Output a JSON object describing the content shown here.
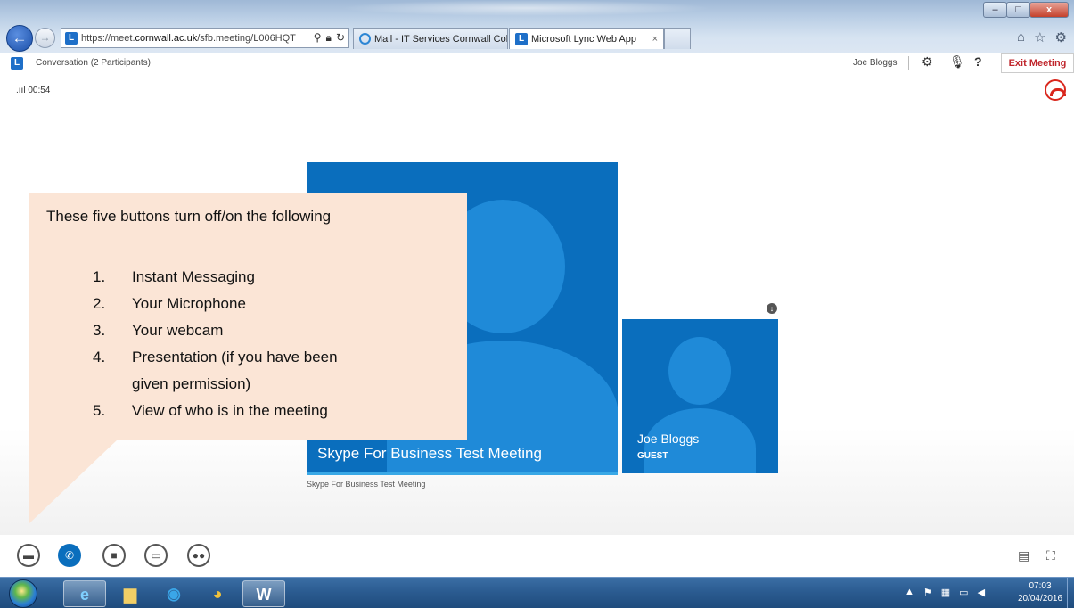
{
  "browser": {
    "url_prefix": "https://meet.",
    "url_domain": "cornwall.ac.uk",
    "url_path": "/sfb.meeting/L006HQT",
    "tabs": [
      {
        "label": "Mail - IT Services Cornwall Coll..."
      },
      {
        "label": "Microsoft Lync Web App",
        "close": "×"
      }
    ]
  },
  "header": {
    "conversation_title": "Conversation (2 Participants)",
    "user_name": "Joe Bloggs",
    "exit_label": "Exit Meeting"
  },
  "call": {
    "duration": "00:54",
    "signal_glyph": ".ııl"
  },
  "stage": {
    "main_tile_label": "Skype For Business Test Meeting",
    "main_tile_caption": "Skype For Business Test Meeting",
    "guest_name": "Joe Bloggs",
    "guest_role": "GUEST"
  },
  "callout": {
    "heading": "These five buttons turn off/on the following",
    "items": [
      {
        "num": "1.",
        "text": "Instant Messaging"
      },
      {
        "num": "2.",
        "text": "Your Microphone"
      },
      {
        "num": "3.",
        "text": "Your webcam"
      },
      {
        "num": "4.",
        "text": "Presentation (if you have been",
        "cont": "given permission)"
      },
      {
        "num": "5.",
        "text": "View of who is in the meeting"
      }
    ]
  },
  "controls": [
    {
      "name": "instant-messaging-button",
      "icon": "chat-icon",
      "active": false
    },
    {
      "name": "microphone-button",
      "icon": "microphone-icon",
      "active": true
    },
    {
      "name": "webcam-button",
      "icon": "camera-icon",
      "active": false
    },
    {
      "name": "presentation-button",
      "icon": "monitor-icon",
      "active": false
    },
    {
      "name": "participants-button",
      "icon": "people-icon",
      "active": false
    }
  ],
  "taskbar": {
    "clock_time": "07:03",
    "clock_date": "20/04/2016"
  },
  "colors": {
    "tile_blue": "#0a6ebd",
    "avatar_blue": "#1f8ad8",
    "callout_bg": "#fbe5d6",
    "exit_red": "#c0272d",
    "hangup_red": "#d9261c"
  }
}
